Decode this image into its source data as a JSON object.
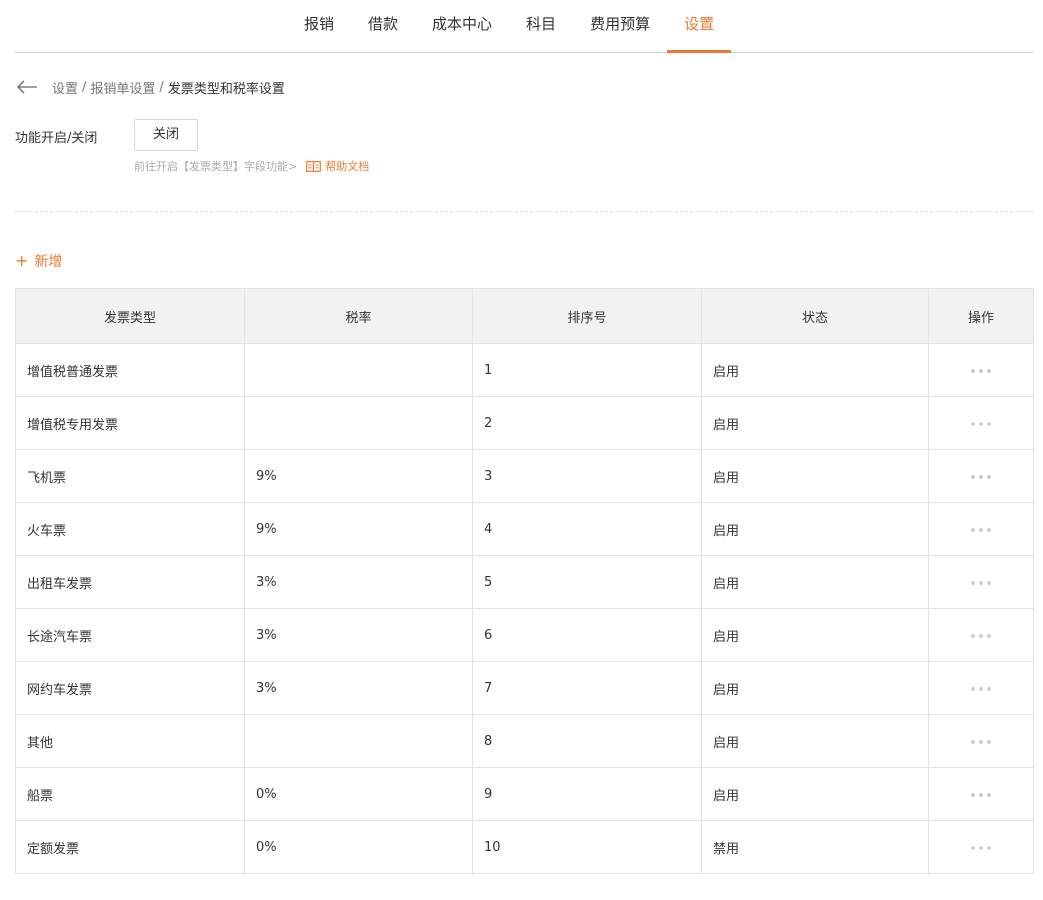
{
  "nav": {
    "tabs": [
      {
        "label": "报销"
      },
      {
        "label": "借款"
      },
      {
        "label": "成本中心"
      },
      {
        "label": "科目"
      },
      {
        "label": "费用预算"
      },
      {
        "label": "设置",
        "active": true
      }
    ]
  },
  "breadcrumb": {
    "items": [
      "设置",
      "报销单设置"
    ],
    "separator": "/",
    "current": "发票类型和税率设置"
  },
  "feature_toggle": {
    "label": "功能开启/关闭",
    "button_label": "关闭",
    "hint": "前往开启【发票类型】字段功能>",
    "help_link": "帮助文档"
  },
  "add_button": {
    "icon": "+",
    "label": "新增"
  },
  "table": {
    "headers": [
      "发票类型",
      "税率",
      "排序号",
      "状态",
      "操作"
    ],
    "rows": [
      {
        "type": "增值税普通发票",
        "rate": "",
        "order": "1",
        "status": "启用"
      },
      {
        "type": "增值税专用发票",
        "rate": "",
        "order": "2",
        "status": "启用"
      },
      {
        "type": "飞机票",
        "rate": "9%",
        "order": "3",
        "status": "启用"
      },
      {
        "type": "火车票",
        "rate": "9%",
        "order": "4",
        "status": "启用"
      },
      {
        "type": "出租车发票",
        "rate": "3%",
        "order": "5",
        "status": "启用"
      },
      {
        "type": "长途汽车票",
        "rate": "3%",
        "order": "6",
        "status": "启用"
      },
      {
        "type": "网约车发票",
        "rate": "3%",
        "order": "7",
        "status": "启用"
      },
      {
        "type": "其他",
        "rate": "",
        "order": "8",
        "status": "启用"
      },
      {
        "type": "船票",
        "rate": "0%",
        "order": "9",
        "status": "启用"
      },
      {
        "type": "定额发票",
        "rate": "0%",
        "order": "10",
        "status": "禁用"
      }
    ]
  },
  "colors": {
    "accent": "#f0782c",
    "header_bg": "#f2f2f2",
    "border": "#e3e3e3"
  },
  "icons": {
    "back": "arrow-left-icon",
    "help": "book-icon",
    "row_action": "more-dots-icon"
  }
}
